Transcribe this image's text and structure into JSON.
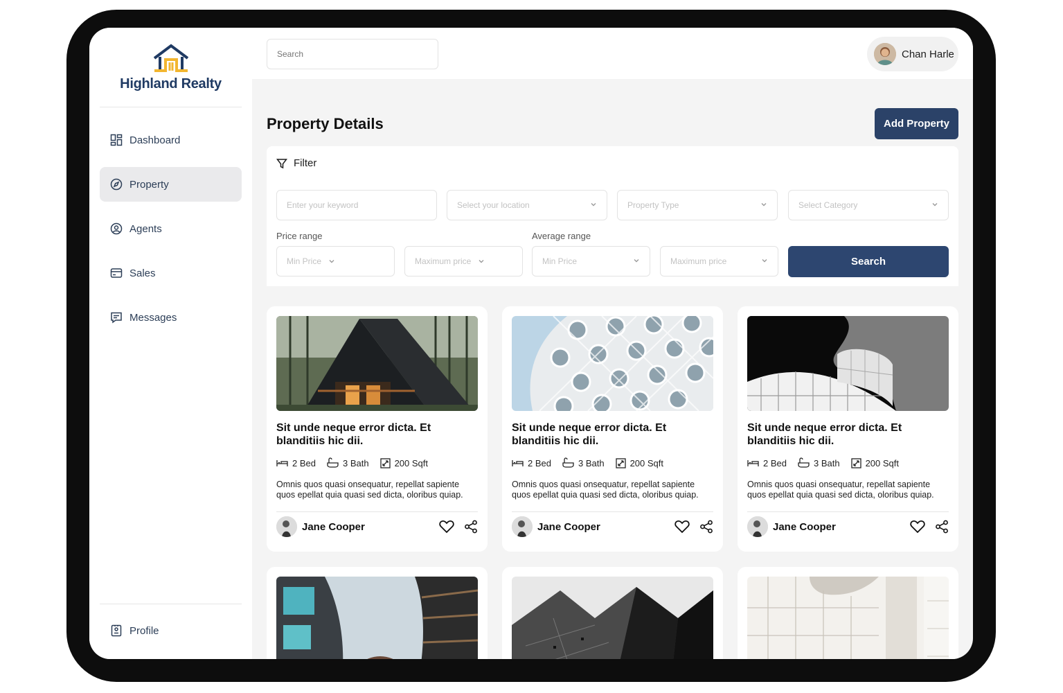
{
  "brand": {
    "name": "Highland Realty",
    "colors": {
      "navy": "#1f3a63",
      "gold": "#f2b630",
      "button": "#2b4268"
    }
  },
  "search": {
    "placeholder": "Search"
  },
  "user": {
    "name": "Chan Harle"
  },
  "sidebar": {
    "items": [
      {
        "label": "Dashboard",
        "icon": "dashboard-icon"
      },
      {
        "label": "Property",
        "icon": "compass-icon",
        "active": true
      },
      {
        "label": "Agents",
        "icon": "user-circle-icon"
      },
      {
        "label": "Sales",
        "icon": "card-icon"
      },
      {
        "label": "Messages",
        "icon": "message-icon"
      }
    ],
    "profile": {
      "label": "Profile",
      "icon": "id-card-icon"
    }
  },
  "main": {
    "title": "Property Details",
    "add_button": "Add Property",
    "filter": {
      "label": "Filter",
      "keyword_placeholder": "Enter your keyword",
      "location_placeholder": "Select your location",
      "type_placeholder": "Property Type",
      "category_placeholder": "Select Category",
      "price_range_label": "Price range",
      "average_range_label": "Average range",
      "price_min": "Min Price",
      "price_max": "Maximum price",
      "avg_min": "Min Price",
      "avg_max": "Maximum price",
      "search_button": "Search"
    },
    "cards": [
      {
        "title": "Sit unde neque error dicta. Et blanditiis hic dii.",
        "bed": "2 Bed",
        "bath": "3 Bath",
        "area": "200 Sqft",
        "description": "Omnis quos quasi onsequatur, repellat sapiente quos epellat quia quasi sed dicta, oloribus quiap.",
        "agent": "Jane Cooper"
      },
      {
        "title": "Sit unde neque error dicta. Et blanditiis hic dii.",
        "bed": "2 Bed",
        "bath": "3 Bath",
        "area": "200 Sqft",
        "description": "Omnis quos quasi onsequatur, repellat sapiente quos epellat quia quasi sed dicta, oloribus quiap.",
        "agent": "Jane Cooper"
      },
      {
        "title": "Sit unde neque error dicta. Et blanditiis hic dii.",
        "bed": "2 Bed",
        "bath": "3 Bath",
        "area": "200 Sqft",
        "description": "Omnis quos quasi onsequatur, repellat sapiente quos epellat quia quasi sed dicta, oloribus quiap.",
        "agent": "Jane Cooper"
      }
    ]
  }
}
